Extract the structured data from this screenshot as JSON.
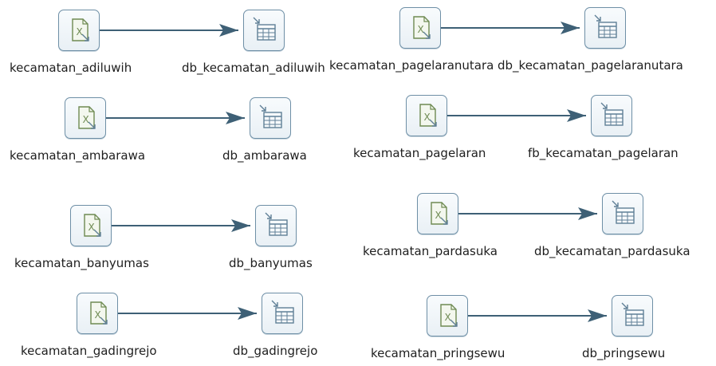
{
  "colors": {
    "hop_line": "#3e6076",
    "step_border": "#6e8fa6",
    "excel_icon": "#6e8a52",
    "table_icon": "#5f7f96",
    "background": "#ffffff"
  },
  "icons": {
    "input": "excel-input-icon",
    "output": "table-output-icon"
  },
  "transformations": [
    {
      "input_label": "kecamatan_adiluwih",
      "output_label": "db_kecamatan_adiluwih"
    },
    {
      "input_label": "kecamatan_ambarawa",
      "output_label": "db_ambarawa"
    },
    {
      "input_label": "kecamatan_banyumas",
      "output_label": "db_banyumas"
    },
    {
      "input_label": "kecamatan_gadingrejo",
      "output_label": "db_gadingrejo"
    },
    {
      "input_label": "kecamatan_pagelaranutara",
      "output_label": "db_kecamatan_pagelaranutara"
    },
    {
      "input_label": "kecamatan_pagelaran",
      "output_label": "fb_kecamatan_pagelaran"
    },
    {
      "input_label": "kecamatan_pardasuka",
      "output_label": "db_kecamatan_pardasuka"
    },
    {
      "input_label": "kecamatan_pringsewu",
      "output_label": "db_pringsewu"
    }
  ]
}
